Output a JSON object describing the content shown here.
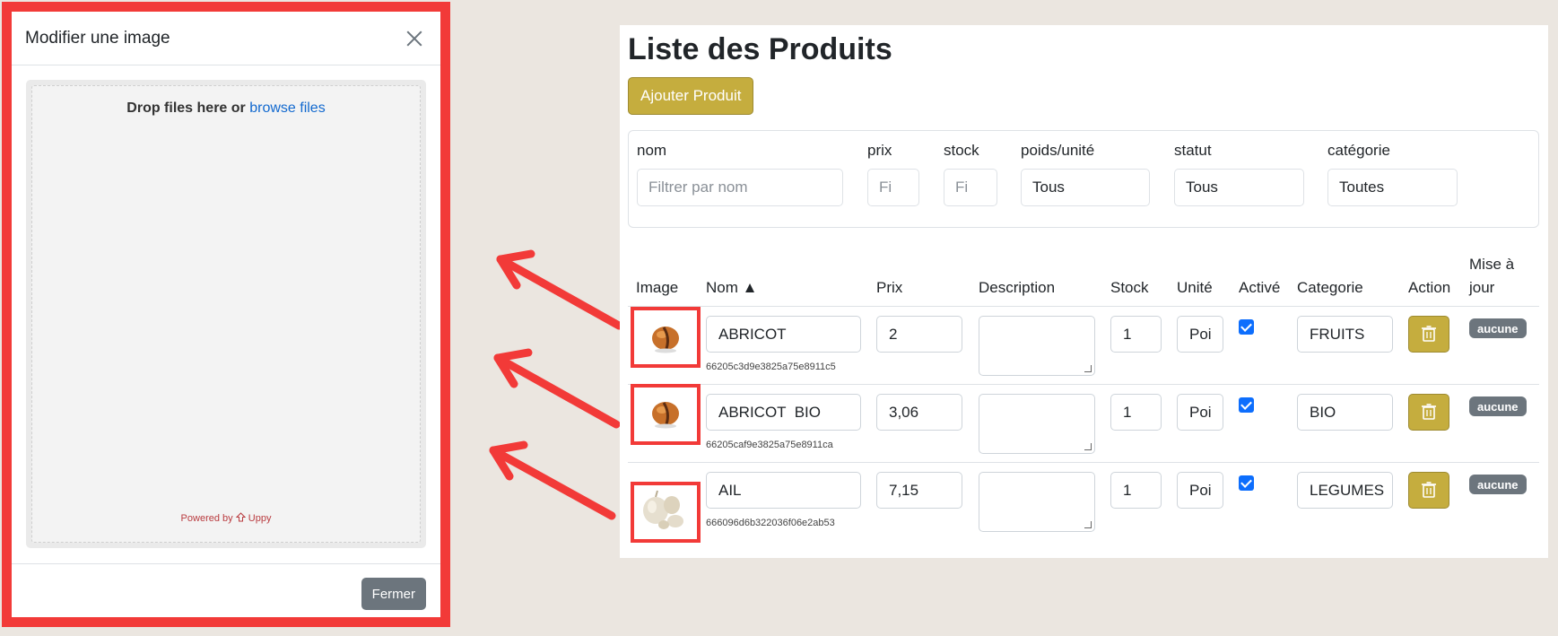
{
  "modal": {
    "title": "Modifier une image",
    "drop_text": "Drop files here or",
    "browse_text": "browse files",
    "powered_by": "Powered by",
    "powered_brand": "Uppy",
    "close_label": "Fermer"
  },
  "products_panel": {
    "title": "Liste des Produits",
    "add_button": "Ajouter Produit",
    "filters": [
      {
        "label": "nom",
        "value": "",
        "placeholder": "Filtrer par nom"
      },
      {
        "label": "prix",
        "value": "",
        "placeholder": "Fi"
      },
      {
        "label": "stock",
        "value": "",
        "placeholder": "Fi"
      },
      {
        "label": "poids/unité",
        "value": "Tous"
      },
      {
        "label": "statut",
        "value": "Tous"
      },
      {
        "label": "catégorie",
        "value": "Toutes"
      }
    ],
    "columns": [
      "Image",
      "Nom ▲",
      "Prix",
      "Description",
      "Stock",
      "Unité",
      "Activé",
      "Categorie",
      "Action",
      "Mise à",
      "jour"
    ],
    "rows": [
      {
        "image": "apricot-image",
        "name": "ABRICOT",
        "id": "66205c3d9e3825a75e8911c5",
        "price": "2",
        "description": "",
        "stock": "1",
        "unit": "Poi",
        "active": true,
        "category": "FRUITS",
        "update": "aucune"
      },
      {
        "image": "apricot-image",
        "name": "ABRICOT  BIO",
        "id": "66205caf9e3825a75e8911ca",
        "price": "3,06",
        "description": "",
        "stock": "1",
        "unit": "Poi",
        "active": true,
        "category": "BIO",
        "update": "aucune"
      },
      {
        "image": "garlic-image",
        "name": "AIL",
        "id": "666096d6b322036f06e2ab53",
        "price": "7,15",
        "description": "",
        "stock": "1",
        "unit": "Poi",
        "active": true,
        "category": "LEGUMES",
        "update": "aucune"
      }
    ]
  },
  "colors": {
    "background": "#ebe6e0",
    "highlight_red": "#f23a38",
    "gold_button": "#c5ad3e",
    "secondary_grey": "#6c757d",
    "link_blue": "#1269cf",
    "checkbox_blue": "#0d6efd"
  }
}
